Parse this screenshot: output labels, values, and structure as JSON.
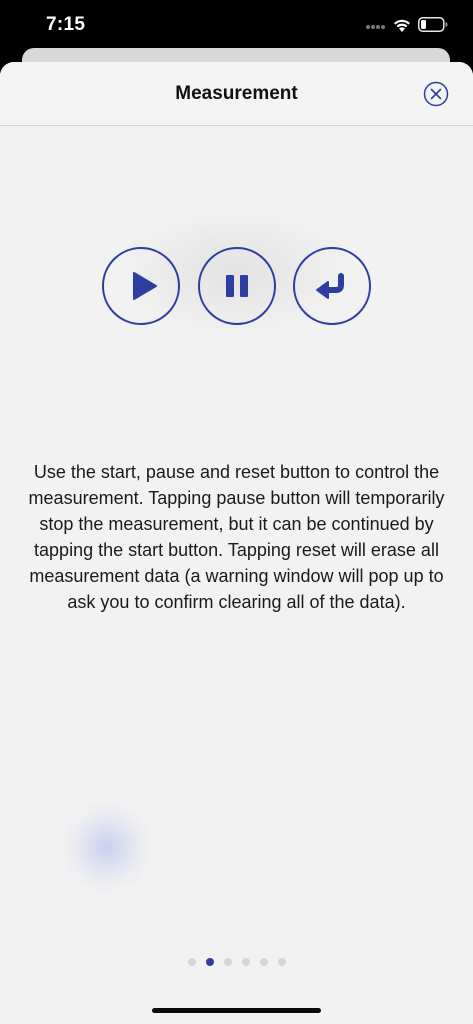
{
  "status_bar": {
    "time": "7:15",
    "icons": [
      "cellular-icon",
      "wifi-icon",
      "battery-icon"
    ]
  },
  "sheet": {
    "title": "Measurement",
    "close_icon": "close-circle-icon"
  },
  "controls": {
    "start": {
      "icon": "play-icon",
      "label": "Start"
    },
    "pause": {
      "icon": "pause-icon",
      "label": "Pause"
    },
    "reset": {
      "icon": "reset-arrow-icon",
      "label": "Reset"
    }
  },
  "description": "Use the start, pause and reset button to control the measurement. Tapping pause button will temporarily stop the measurement, but it can be continued by tapping the start button. Tapping reset will erase all measurement data (a warning window will pop up to ask you to confirm clearing all of the data).",
  "pagination": {
    "total": 6,
    "current": 2
  },
  "colors": {
    "accent": "#2e3ea0",
    "sheet_background": "#f2f2f2",
    "status_bar_background": "#000000"
  }
}
